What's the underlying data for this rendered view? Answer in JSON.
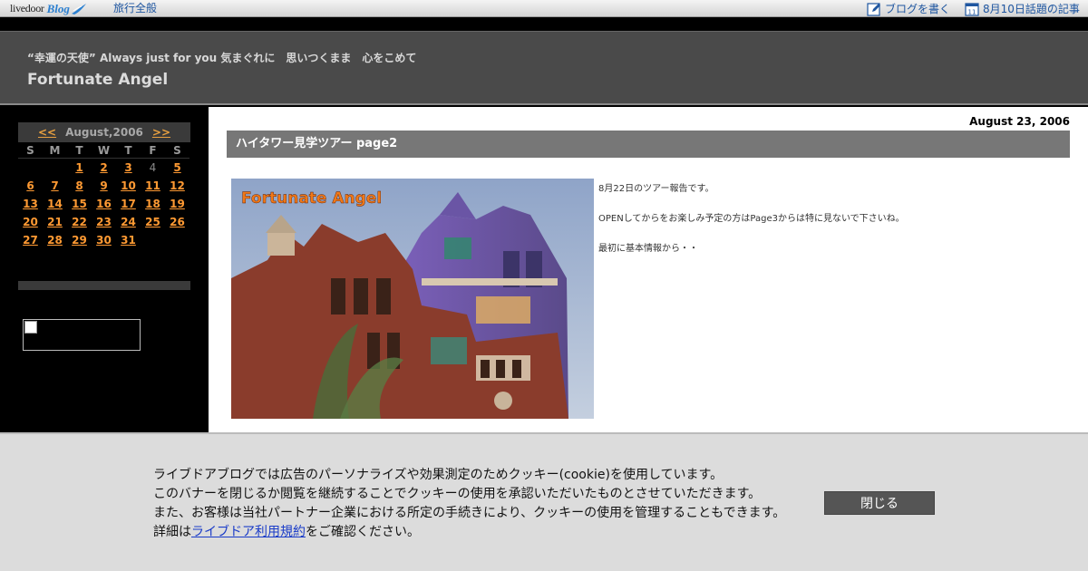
{
  "topbar": {
    "logo_word": "livedoor",
    "logo_blog": "Blog",
    "category_link": "旅行全般",
    "write_link": "ブログを書く",
    "topic_link": "8月10日話題の記事",
    "calendar_icon_day": "11"
  },
  "header": {
    "tagline": "“幸運の天使” Always just for you 気まぐれに　思いつくまま　心をこめて",
    "title": "Fortunate Angel"
  },
  "calendar": {
    "prev": "<<",
    "month": "August,2006",
    "next": ">>",
    "dow": [
      "S",
      "M",
      "T",
      "W",
      "T",
      "F",
      "S"
    ],
    "days": [
      "",
      "",
      "1",
      "2",
      "3",
      "4",
      "5",
      "6",
      "7",
      "8",
      "9",
      "10",
      "11",
      "12",
      "13",
      "14",
      "15",
      "16",
      "17",
      "18",
      "19",
      "20",
      "21",
      "22",
      "23",
      "24",
      "25",
      "26",
      "27",
      "28",
      "29",
      "30",
      "31"
    ],
    "non_linked_day": "4"
  },
  "entry": {
    "date": "August 23, 2006",
    "title": "ハイタワー見学ツアー page2",
    "photo_watermark": "Fortunate Angel",
    "paragraphs": [
      "8月22日のツアー報告です。",
      "OPENしてからをお楽しみ予定の方はPage3からは特に見ないで下さいね。",
      "最初に基本情報から・・"
    ]
  },
  "cookie": {
    "line1": "ライブドアブログでは広告のパーソナライズや効果測定のためクッキー(cookie)を使用しています。",
    "line2": "このバナーを閉じるか閲覧を継続することでクッキーの使用を承認いただいたものとさせていただきます。",
    "line3": "また、お客様は当社パートナー企業における所定の手続きにより、クッキーの使用を管理することもできます。",
    "line4_prefix": "詳細は",
    "line4_link": "ライブドア利用規約",
    "line4_suffix": "をご確認ください。",
    "close": "閉じる"
  },
  "colors": {
    "link_orange": "#ff9a33",
    "header_bg": "#4a4a4a",
    "title_bar": "#777777",
    "cookie_bg": "#dcdcdc",
    "topbar_link": "#1f56a0"
  }
}
